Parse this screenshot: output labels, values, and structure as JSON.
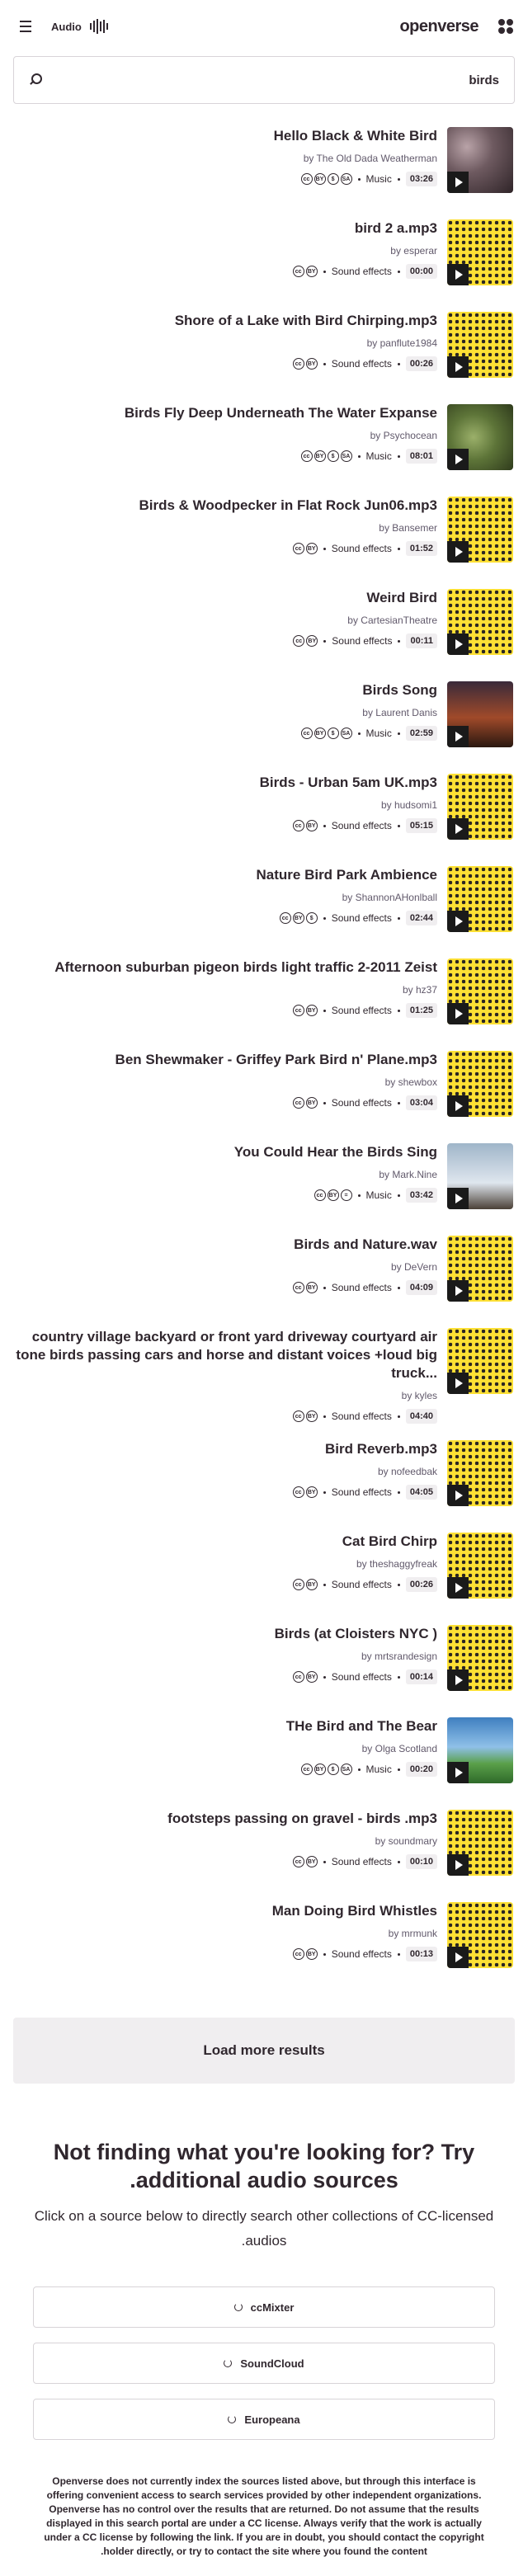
{
  "header": {
    "logo": "openverse",
    "media_type": "Audio"
  },
  "search": {
    "value": "birds",
    "placeholder": ""
  },
  "results": [
    {
      "title": "Hello Black & White Bird",
      "creator": "by The Old Dada Weatherman",
      "category": "Music",
      "duration": "03:26",
      "licenses": [
        "cc",
        "by",
        "nc",
        "sa"
      ],
      "thumb": "photo-birds"
    },
    {
      "title": "bird 2 a.mp3",
      "creator": "by esperar",
      "category": "Sound effects",
      "duration": "00:00",
      "licenses": [
        "cc",
        "by"
      ],
      "thumb": "pattern"
    },
    {
      "title": "Shore of a Lake with Bird Chirping.mp3",
      "creator": "by panflute1984",
      "category": "Sound effects",
      "duration": "00:26",
      "licenses": [
        "cc",
        "by"
      ],
      "thumb": "pattern"
    },
    {
      "title": "Birds Fly Deep Underneath The Water Expanse",
      "creator": "by Psychocean",
      "category": "Music",
      "duration": "08:01",
      "licenses": [
        "cc",
        "by",
        "nc",
        "sa"
      ],
      "thumb": "photo-lizard"
    },
    {
      "title": "Birds & Woodpecker in Flat Rock Jun06.mp3",
      "creator": "by Bansemer",
      "category": "Sound effects",
      "duration": "01:52",
      "licenses": [
        "cc",
        "by"
      ],
      "thumb": "pattern"
    },
    {
      "title": "Weird Bird",
      "creator": "by CartesianTheatre",
      "category": "Sound effects",
      "duration": "00:11",
      "licenses": [
        "cc",
        "by"
      ],
      "thumb": "pattern"
    },
    {
      "title": "Birds Song",
      "creator": "by Laurent Danis",
      "category": "Music",
      "duration": "02:59",
      "licenses": [
        "cc",
        "by",
        "nc",
        "sa"
      ],
      "thumb": "photo-sunset"
    },
    {
      "title": "Birds - Urban 5am UK.mp3",
      "creator": "by hudsomi1",
      "category": "Sound effects",
      "duration": "05:15",
      "licenses": [
        "cc",
        "by"
      ],
      "thumb": "pattern"
    },
    {
      "title": "Nature Bird Park Ambience",
      "creator": "by ShannonAHonlball",
      "category": "Sound effects",
      "duration": "02:44",
      "licenses": [
        "cc",
        "by",
        "nc"
      ],
      "thumb": "pattern"
    },
    {
      "title": "Afternoon suburban pigeon birds light traffic 2-2011 Zeist",
      "creator": "by hz37",
      "category": "Sound effects",
      "duration": "01:25",
      "licenses": [
        "cc",
        "by"
      ],
      "thumb": "pattern"
    },
    {
      "title": "Ben Shewmaker - Griffey Park Bird n' Plane.mp3",
      "creator": "by shewbox",
      "category": "Sound effects",
      "duration": "03:04",
      "licenses": [
        "cc",
        "by"
      ],
      "thumb": "pattern"
    },
    {
      "title": "You Could Hear the Birds Sing",
      "creator": "by Mark.Nine",
      "category": "Music",
      "duration": "03:42",
      "licenses": [
        "cc",
        "by",
        "nd"
      ],
      "thumb": "photo-bird-flight"
    },
    {
      "title": "Birds and Nature.wav",
      "creator": "by DeVern",
      "category": "Sound effects",
      "duration": "04:09",
      "licenses": [
        "cc",
        "by"
      ],
      "thumb": "pattern"
    },
    {
      "title": "country village backyard or front yard driveway courtyard air tone birds passing cars and horse and distant voices +loud big truck...",
      "creator": "by kyles",
      "category": "Sound effects",
      "duration": "04:40",
      "licenses": [
        "cc",
        "by"
      ],
      "thumb": "pattern",
      "two_line": true
    },
    {
      "title": "Bird Reverb.mp3",
      "creator": "by nofeedbak",
      "category": "Sound effects",
      "duration": "04:05",
      "licenses": [
        "cc",
        "by"
      ],
      "thumb": "pattern"
    },
    {
      "title": "Cat Bird Chirp",
      "creator": "by theshaggyfreak",
      "category": "Sound effects",
      "duration": "00:26",
      "licenses": [
        "cc",
        "by"
      ],
      "thumb": "pattern"
    },
    {
      "title": "Birds (at Cloisters NYC )",
      "creator": "by mrtsrandesign",
      "category": "Sound effects",
      "duration": "00:14",
      "licenses": [
        "cc",
        "by"
      ],
      "thumb": "pattern"
    },
    {
      "title": "THe Bird and The Bear",
      "creator": "by Olga Scotland",
      "category": "Music",
      "duration": "00:20",
      "licenses": [
        "cc",
        "by",
        "nc",
        "sa"
      ],
      "thumb": "photo-landscape"
    },
    {
      "title": "footsteps passing on gravel - birds .mp3",
      "creator": "by soundmary",
      "category": "Sound effects",
      "duration": "00:10",
      "licenses": [
        "cc",
        "by"
      ],
      "thumb": "pattern"
    },
    {
      "title": "Man Doing Bird Whistles",
      "creator": "by mrmunk",
      "category": "Sound effects",
      "duration": "00:13",
      "licenses": [
        "cc",
        "by"
      ],
      "thumb": "pattern"
    }
  ],
  "load_more": "Load more results",
  "not_finding": {
    "heading": "Not finding what you're looking for? Try additional audio sources.",
    "text": "Click on a source below to directly search other collections of CC-licensed audios."
  },
  "sources": [
    "ccMixter",
    "SoundCloud",
    "Europeana"
  ],
  "disclaimer": "Openverse does not currently index the sources listed above, but through this interface is offering convenient access to search services provided by other independent organizations. Openverse has no control over the results that are returned. Do not assume that the results displayed in this search portal are under a CC license. Always verify that the work is actually under a CC license by following the link. If you are in doubt, you should contact the copyright holder directly, or try to contact the site where you found the content.",
  "colors": {
    "accent_yellow": "#fde034",
    "text": "#30272e",
    "muted_bg": "#f0eef0"
  }
}
